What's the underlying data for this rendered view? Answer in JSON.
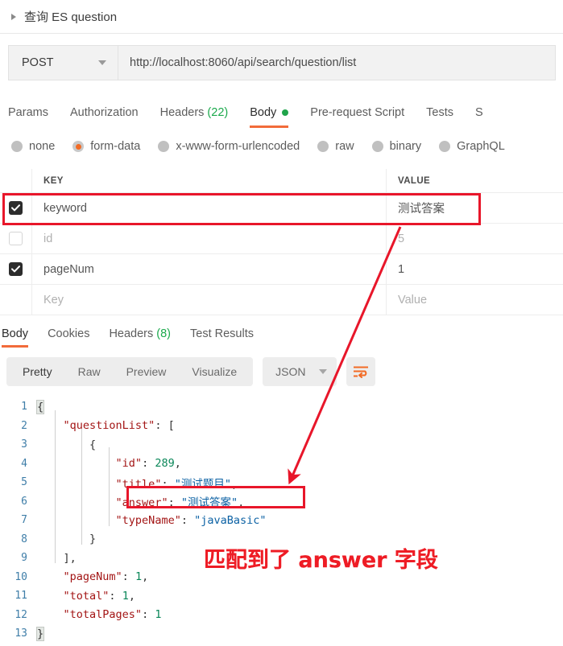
{
  "request": {
    "title": "查询 ES question",
    "collapse_icon": "triangle-right-icon",
    "method": "POST",
    "url": "http://localhost:8060/api/search/question/list",
    "tabs": [
      {
        "label": "Params",
        "active": false
      },
      {
        "label": "Authorization",
        "active": false
      },
      {
        "label": "Headers",
        "count": "(22)",
        "active": false
      },
      {
        "label": "Body",
        "active": true,
        "status_dot": true
      },
      {
        "label": "Pre-request Script",
        "active": false
      },
      {
        "label": "Tests",
        "active": false
      },
      {
        "label": "S",
        "active": false
      }
    ],
    "body_types": [
      {
        "label": "none",
        "selected": false
      },
      {
        "label": "form-data",
        "selected": true
      },
      {
        "label": "x-www-form-urlencoded",
        "selected": false
      },
      {
        "label": "raw",
        "selected": false
      },
      {
        "label": "binary",
        "selected": false
      },
      {
        "label": "GraphQL",
        "selected": false
      }
    ],
    "table": {
      "headers": {
        "key": "KEY",
        "value": "VALUE"
      },
      "rows": [
        {
          "checked": true,
          "key": "keyword",
          "value": "测试答案",
          "placeholder": false,
          "highlighted": true
        },
        {
          "checked": false,
          "key": "id",
          "value": "5",
          "placeholder": true,
          "highlighted": false
        },
        {
          "checked": true,
          "key": "pageNum",
          "value": "1",
          "placeholder": false,
          "highlighted": false
        },
        {
          "checked": null,
          "key": "Key",
          "value": "Value",
          "placeholder": true,
          "highlighted": false
        }
      ]
    }
  },
  "response": {
    "tabs": [
      {
        "label": "Body",
        "active": true
      },
      {
        "label": "Cookies",
        "active": false
      },
      {
        "label": "Headers",
        "count": "(8)",
        "active": false
      },
      {
        "label": "Test Results",
        "active": false
      }
    ],
    "view_modes": [
      {
        "label": "Pretty",
        "active": true
      },
      {
        "label": "Raw",
        "active": false
      },
      {
        "label": "Preview",
        "active": false
      },
      {
        "label": "Visualize",
        "active": false
      }
    ],
    "format": "JSON",
    "wrap_icon": "word-wrap-icon",
    "code_lines": [
      {
        "no": "1",
        "segments": [
          {
            "t": "{",
            "c": "brace-hl"
          }
        ]
      },
      {
        "no": "2",
        "segments": [
          {
            "t": "    ",
            "c": "p"
          },
          {
            "t": "\"questionList\"",
            "c": "k"
          },
          {
            "t": ": [",
            "c": "p"
          }
        ]
      },
      {
        "no": "3",
        "segments": [
          {
            "t": "        {",
            "c": "p"
          }
        ]
      },
      {
        "no": "4",
        "segments": [
          {
            "t": "            ",
            "c": "p"
          },
          {
            "t": "\"id\"",
            "c": "k"
          },
          {
            "t": ": ",
            "c": "p"
          },
          {
            "t": "289",
            "c": "n"
          },
          {
            "t": ",",
            "c": "p"
          }
        ]
      },
      {
        "no": "5",
        "segments": [
          {
            "t": "            ",
            "c": "p"
          },
          {
            "t": "\"title\"",
            "c": "k"
          },
          {
            "t": ": ",
            "c": "p"
          },
          {
            "t": "\"测试题目\"",
            "c": "s"
          },
          {
            "t": ",",
            "c": "p"
          }
        ]
      },
      {
        "no": "6",
        "segments": [
          {
            "t": "            ",
            "c": "p"
          },
          {
            "t": "\"answer\"",
            "c": "k"
          },
          {
            "t": ": ",
            "c": "p"
          },
          {
            "t": "\"测试答案\"",
            "c": "s"
          },
          {
            "t": ",",
            "c": "p"
          }
        ]
      },
      {
        "no": "7",
        "segments": [
          {
            "t": "            ",
            "c": "p"
          },
          {
            "t": "\"typeName\"",
            "c": "k"
          },
          {
            "t": ": ",
            "c": "p"
          },
          {
            "t": "\"javaBasic\"",
            "c": "s"
          }
        ]
      },
      {
        "no": "8",
        "segments": [
          {
            "t": "        }",
            "c": "p"
          }
        ]
      },
      {
        "no": "9",
        "segments": [
          {
            "t": "    ],",
            "c": "p"
          }
        ]
      },
      {
        "no": "10",
        "segments": [
          {
            "t": "    ",
            "c": "p"
          },
          {
            "t": "\"pageNum\"",
            "c": "k"
          },
          {
            "t": ": ",
            "c": "p"
          },
          {
            "t": "1",
            "c": "n"
          },
          {
            "t": ",",
            "c": "p"
          }
        ]
      },
      {
        "no": "11",
        "segments": [
          {
            "t": "    ",
            "c": "p"
          },
          {
            "t": "\"total\"",
            "c": "k"
          },
          {
            "t": ": ",
            "c": "p"
          },
          {
            "t": "1",
            "c": "n"
          },
          {
            "t": ",",
            "c": "p"
          }
        ]
      },
      {
        "no": "12",
        "segments": [
          {
            "t": "    ",
            "c": "p"
          },
          {
            "t": "\"totalPages\"",
            "c": "k"
          },
          {
            "t": ": ",
            "c": "p"
          },
          {
            "t": "1",
            "c": "n"
          }
        ]
      },
      {
        "no": "13",
        "segments": [
          {
            "t": "}",
            "c": "brace-hl"
          }
        ]
      }
    ]
  },
  "annotations": {
    "callout_text": "匹配到了 answer 字段",
    "box_color": "#e8162a",
    "arrow_color": "#e8162a",
    "text_color": "#ee1c25"
  }
}
